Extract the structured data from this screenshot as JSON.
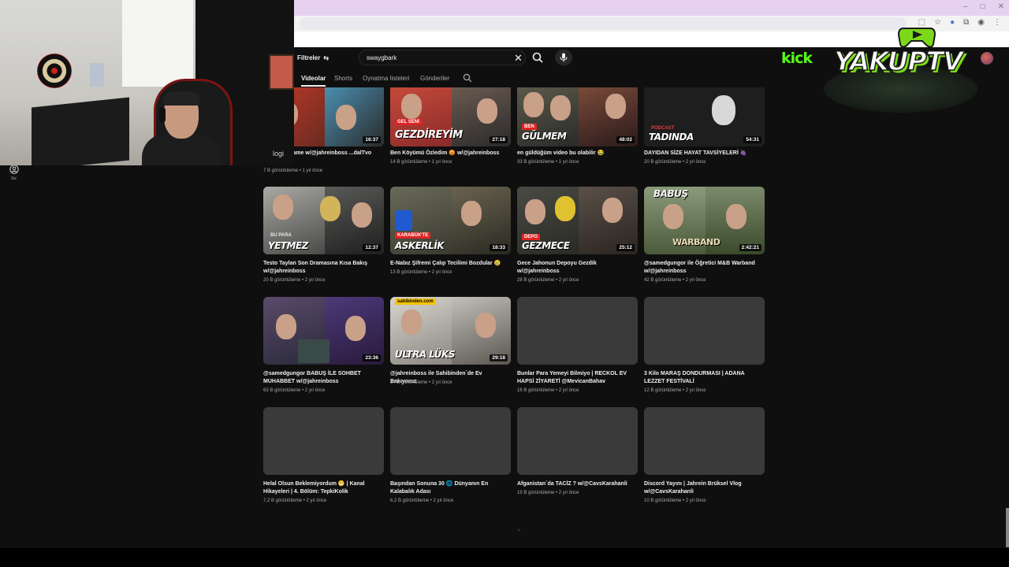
{
  "browser": {
    "window_controls": [
      "–",
      "□",
      "✕"
    ],
    "icons": [
      "install-icon",
      "star-icon",
      "extension-icon",
      "puzzle-icon",
      "profile-icon",
      "menu-icon"
    ]
  },
  "header": {
    "filters_label": "Filtreler",
    "search_value": "swaygbark"
  },
  "tabs": [
    {
      "label": "Videolar",
      "active": true
    },
    {
      "label": "Shorts"
    },
    {
      "label": "Oynatma listeleri"
    },
    {
      "label": "Gönderiler"
    }
  ],
  "rail": {
    "you_label": "Siz"
  },
  "webcam": {
    "label": "logi"
  },
  "overlay": {
    "kick_label": "kick",
    "logo_text": "YAKUPTV"
  },
  "videos": [
    {
      "title": "... ss The Game w/@jahreinboss ...dalTvo",
      "meta": "7 B görüntüleme • 1 yıl önce",
      "duration": "16:37",
      "caption": ""
    },
    {
      "title": "Ben Köyümü Özledim 😡 w/@jahreinboss",
      "meta": "14 B görüntüleme • 1 yıl önce",
      "duration": "27:18",
      "caption": "GEZDİREYİM",
      "tag": "GEL SENİ"
    },
    {
      "title": "en güldüğüm video bu olabilir 😂",
      "meta": "33 B görüntüleme • 1 yıl önce",
      "duration": "48:02",
      "caption": "GÜLMEM",
      "tag": "BEN"
    },
    {
      "title": "DAYIDAN SİZE HAYAT TAVSİYELERİ 🍇",
      "meta": "20 B görüntüleme • 2 yıl önce",
      "duration": "54:31",
      "caption": "TADINDA",
      "tag": "PODCAST"
    },
    {
      "title": "Testo Taylan Son Dramasına Kısa Bakış w/@jahreinboss",
      "meta": "20 B görüntüleme • 2 yıl önce",
      "duration": "12:37",
      "caption": "YETMEZ",
      "tag": "BU PARA"
    },
    {
      "title": "E-Nabız Şifremi Çalıp Tecilimi Bozdular 😢",
      "meta": "13 B görüntüleme • 2 yıl önce",
      "duration": "18:33",
      "caption": "ASKERLİK",
      "tag": "KARABÜK'TE"
    },
    {
      "title": "Gece Jahonun Depoyu Gezdik w/@jahreinboss",
      "meta": "28 B görüntüleme • 2 yıl önce",
      "duration": "25:12",
      "caption": "GEZMECE",
      "tag": "DEPO"
    },
    {
      "title": "@samedgungor ile Öğretici M&B Warband w/@jahreinboss",
      "meta": "42 B görüntüleme • 2 yıl önce",
      "duration": "2:42:21",
      "caption": "WARBAND",
      "tag": "BABUŞ"
    },
    {
      "title": "@samedgungor BABUŞ İLE SOHBET MUHABBET w/@jahreinboss",
      "meta": "63 B görüntüleme • 2 yıl önce",
      "duration": "23:36",
      "caption": "",
      "tag": ""
    },
    {
      "title": "@jahreinboss ile Sahibinden`de Ev Bakıyoruz",
      "meta": "34 B görüntüleme • 2 yıl önce",
      "duration": "29:18",
      "caption": "ULTRA LÜKS",
      "tag": "sahibinden.com"
    },
    {
      "title": "Bunlar Para Yemeyi Bilmiyo | RECKOL EV HAPSİ ZİYARETİ @MevicanBahav",
      "meta": "16 B görüntüleme • 2 yıl önce",
      "duration": ""
    },
    {
      "title": "3 Kilo MARAŞ DONDURMASI | ADANA LEZZET FESTİVALİ",
      "meta": "12 B görüntüleme • 2 yıl önce",
      "duration": ""
    },
    {
      "title": "Helal Olsun Beklemiyordum 😬 | Kanal Hikayeleri | 4. Bölüm: TepkiKolik",
      "meta": "7,2 B görüntüleme • 2 yıl önce",
      "duration": ""
    },
    {
      "title": "Başından Sonuna 30 🌐 Dünyanın En Kalabalık Adası",
      "meta": "6,2 B görüntüleme • 2 yıl önce",
      "duration": ""
    },
    {
      "title": "Afganistan`da TACİZ ? w/@CavsKarahanli",
      "meta": "15 B görüntüleme • 2 yıl önce",
      "duration": ""
    },
    {
      "title": "Discord Yayını | Jahrein Brüksel Vlog w/@CavsKarahanli",
      "meta": "10 B görüntüleme • 2 yıl önce",
      "duration": ""
    }
  ]
}
